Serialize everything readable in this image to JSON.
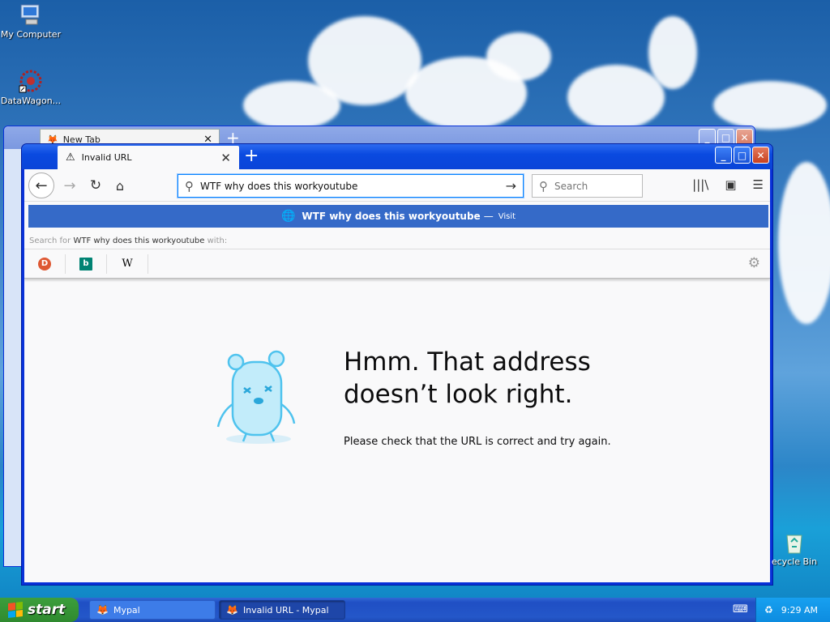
{
  "desktop": {
    "icons": [
      {
        "label": "My Computer",
        "icon": "my-computer-icon"
      },
      {
        "label": "DataWagon...",
        "icon": "datawagon-icon"
      }
    ],
    "recycle_bin": "ecycle Bin"
  },
  "back_window": {
    "tab_title": "New Tab",
    "tab_close": "✕",
    "new_tab": "+"
  },
  "window": {
    "tab_title": "Invalid URL",
    "tab_close": "✕",
    "new_tab": "+",
    "controls": {
      "minimize": "_",
      "maximize": "□",
      "close": "✕"
    }
  },
  "toolbar": {
    "url_value": "WTF why does this workyoutube",
    "search_placeholder": "Search"
  },
  "dropdown": {
    "suggestion_text": "WTF why does this workyoutube",
    "suggestion_sep": "—",
    "suggestion_action": "Visit",
    "search_for_prefix": "Search for",
    "search_for_query": "WTF why does this workyoutube",
    "search_for_suffix": "with:",
    "engines": [
      {
        "name": "duckduckgo",
        "glyph": "D",
        "color": "#de5833"
      },
      {
        "name": "bing",
        "glyph": "b",
        "color": "#008373"
      },
      {
        "name": "wikipedia",
        "glyph": "W",
        "color": "#000000"
      }
    ]
  },
  "error": {
    "title": "Hmm. That address doesn’t look right.",
    "description": "Please check that the URL is correct and try again."
  },
  "taskbar": {
    "start_label": "start",
    "tasks": [
      {
        "label": "Mypal",
        "active": false
      },
      {
        "label": "Invalid URL - Mypal",
        "active": true
      }
    ],
    "clock": "9:29 AM"
  },
  "colors": {
    "accent": "#0a84ff",
    "suggestion_bg": "#356ac8",
    "xp_title": "#0a4ae0"
  }
}
